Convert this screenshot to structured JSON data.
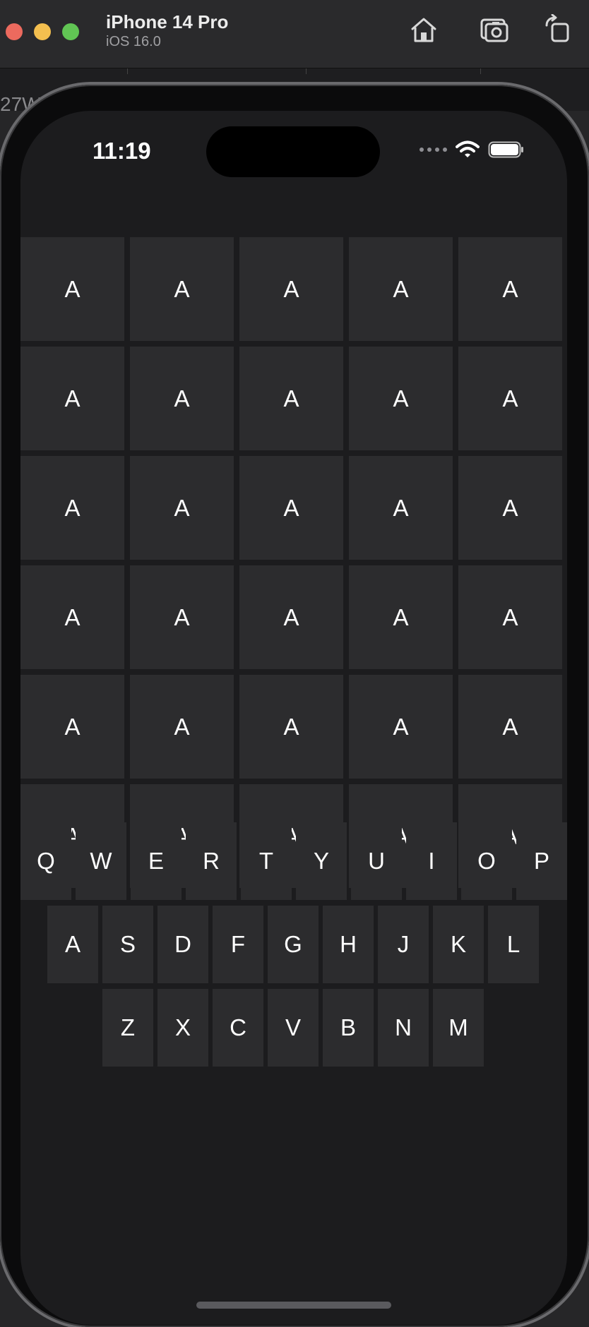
{
  "window": {
    "device_name": "iPhone 14 Pro",
    "os_version": "iOS 16.0",
    "partial_text": "27W",
    "icons": [
      "home-icon",
      "screenshot-icon",
      "rotate-icon"
    ]
  },
  "status_bar": {
    "time": "11:19",
    "icons": [
      "cellular-dots-icon",
      "wifi-icon",
      "battery-icon"
    ]
  },
  "board": {
    "rows": [
      [
        "A",
        "A",
        "A",
        "A",
        "A"
      ],
      [
        "A",
        "A",
        "A",
        "A",
        "A"
      ],
      [
        "A",
        "A",
        "A",
        "A",
        "A"
      ],
      [
        "A",
        "A",
        "A",
        "A",
        "A"
      ],
      [
        "A",
        "A",
        "A",
        "A",
        "A"
      ],
      [
        "A",
        "A",
        "A",
        "A",
        "A"
      ]
    ]
  },
  "keyboard": {
    "rows": [
      [
        "Q",
        "W",
        "E",
        "R",
        "T",
        "Y",
        "U",
        "I",
        "O",
        "P"
      ],
      [
        "A",
        "S",
        "D",
        "F",
        "G",
        "H",
        "J",
        "K",
        "L"
      ],
      [
        "Z",
        "X",
        "C",
        "V",
        "B",
        "N",
        "M"
      ]
    ]
  },
  "colors": {
    "background": "#1c1c1e",
    "tile": "#2c2c2e",
    "text": "#ffffff"
  }
}
